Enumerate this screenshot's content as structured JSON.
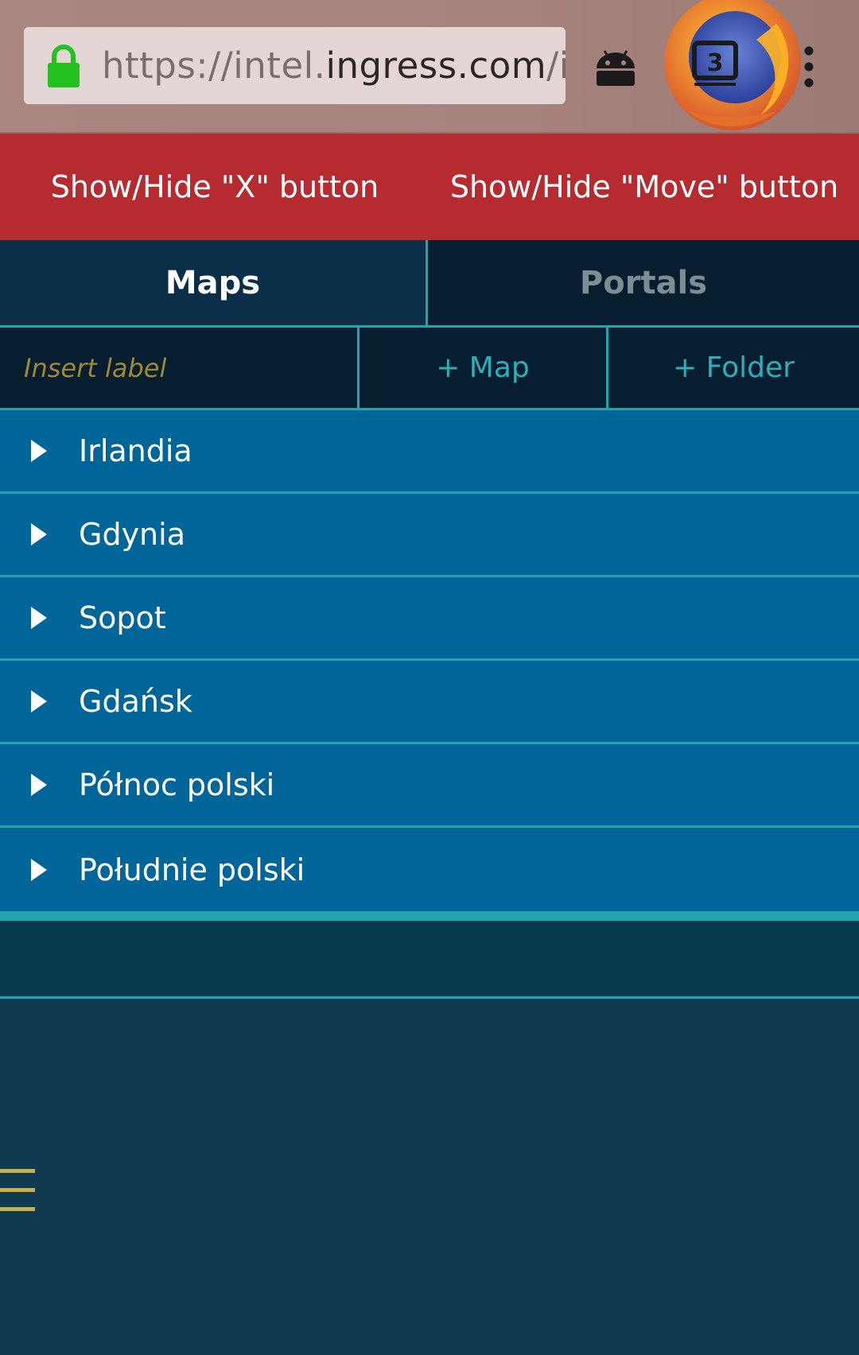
{
  "browser": {
    "url_prefix": "https://intel.",
    "url_domain": "ingress.com",
    "url_suffix": "/in",
    "tab_count": "3",
    "icons": {
      "lock": "lock-icon",
      "android": "android-icon",
      "tabs": "tabs-icon",
      "menu": "menu-icon",
      "firefox": "firefox-logo"
    },
    "colors": {
      "lock": "#22c11f",
      "toolbar": "#a9867e"
    }
  },
  "toggles": {
    "x_button_label": "Show/Hide \"X\" button",
    "move_button_label": "Show/Hide \"Move\" button"
  },
  "tabs": [
    {
      "label": "Maps",
      "active": true
    },
    {
      "label": "Portals",
      "active": false
    }
  ],
  "controls": {
    "label_placeholder": "Insert label",
    "add_map_label": "+ Map",
    "add_folder_label": "+ Folder"
  },
  "folders": [
    {
      "name": "Irlandia"
    },
    {
      "name": "Gdynia"
    },
    {
      "name": "Sopot"
    },
    {
      "name": "Gdańsk"
    },
    {
      "name": "Północ polski"
    },
    {
      "name": "Południe polski"
    }
  ],
  "theme": {
    "accent": "#1fa6b0",
    "list_bg": "#00669a",
    "header_red": "#b52b2f",
    "dark_bg": "#061e30",
    "hamburger": "#c8b04a"
  }
}
